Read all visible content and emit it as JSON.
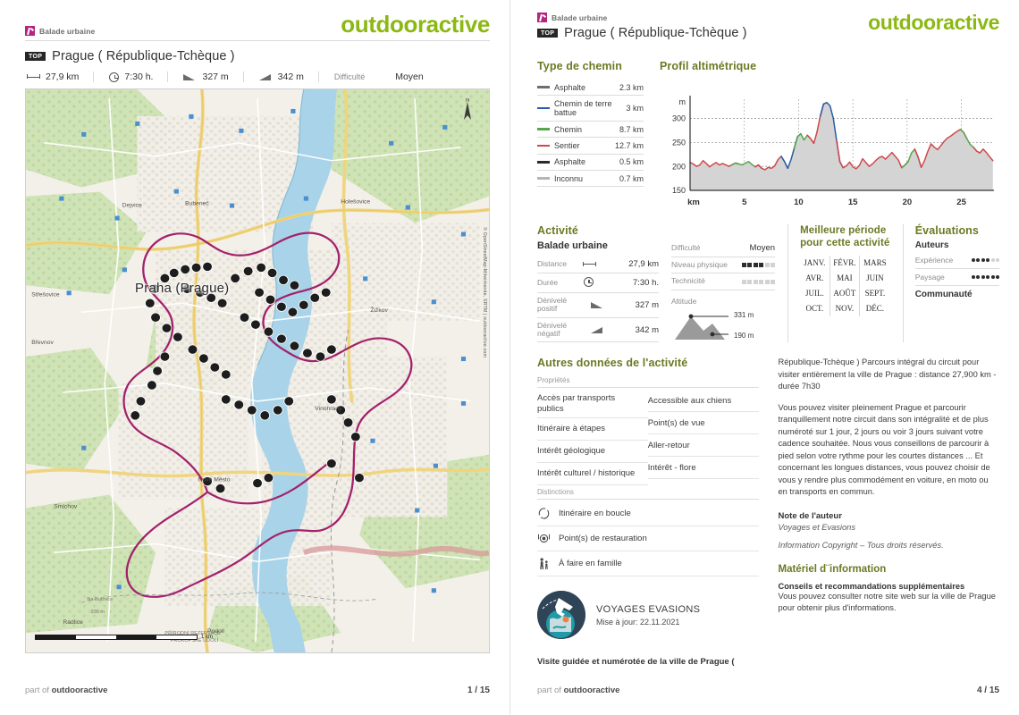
{
  "brand": "outdooractive",
  "category": "Balade urbaine",
  "top_badge": "TOP",
  "tour_title": "Prague ( République-Tchèque )",
  "stats": [
    {
      "icon": "distance-icon",
      "label": "",
      "value": "27,9 km"
    },
    {
      "icon": "clock-icon",
      "label": "",
      "value": "7:30 h."
    },
    {
      "icon": "ascent-icon",
      "label": "",
      "value": "327 m"
    },
    {
      "icon": "descent-icon",
      "label": "",
      "value": "342 m"
    },
    {
      "icon": "",
      "label": "Difficulté",
      "value": "Moyen"
    }
  ],
  "map": {
    "city_label": "Praha (Prague)",
    "attribution": "© OpenStreetMap-Mitwirkende, SRTM | outdooractive.com",
    "scale_text": "1 km",
    "compass_label": "N",
    "route_color": "#a3216b",
    "waypoint_count": 60
  },
  "path_types": {
    "heading": "Type de chemin",
    "rows": [
      {
        "name": "Asphalte",
        "value": "2.3 km",
        "color": "#6e6e6e"
      },
      {
        "name": "Chemin de terre battue",
        "value": "3 km",
        "color": "#2a5ca8"
      },
      {
        "name": "Chemin",
        "value": "8.7 km",
        "color": "#56a64b"
      },
      {
        "name": "Sentier",
        "value": "12.7 km",
        "color": "#d0484c"
      },
      {
        "name": "Asphalte",
        "value": "0.5 km",
        "color": "#2a2a2a"
      },
      {
        "name": "Inconnu",
        "value": "0.7 km",
        "color": "#b4b4b4"
      }
    ]
  },
  "chart_data": {
    "type": "area",
    "title": "Profil altimétrique",
    "xlabel": "km",
    "ylabel": "m",
    "xlim": [
      0,
      28
    ],
    "ylim": [
      150,
      340
    ],
    "xticks": [
      5,
      10,
      15,
      20,
      25
    ],
    "yticks": [
      150,
      200,
      250,
      300
    ],
    "grid": true,
    "legend": "none",
    "series_colors": {
      "Asphalte": "#6e6e6e",
      "Chemin de terre battue": "#2a5ca8",
      "Chemin": "#56a64b",
      "Sentier": "#d0484c"
    },
    "fill_color": "#d4d4d4",
    "x": [
      0,
      0.3,
      0.6,
      0.9,
      1.2,
      1.5,
      1.8,
      2.1,
      2.4,
      2.7,
      3,
      3.3,
      3.6,
      3.9,
      4.2,
      4.5,
      4.8,
      5.1,
      5.4,
      5.7,
      6,
      6.3,
      6.6,
      6.9,
      7.2,
      7.5,
      7.8,
      8.1,
      8.4,
      8.7,
      9,
      9.3,
      9.6,
      9.9,
      10.2,
      10.5,
      10.8,
      11.1,
      11.4,
      11.7,
      12,
      12.3,
      12.6,
      12.9,
      13.2,
      13.5,
      13.8,
      14.1,
      14.4,
      14.7,
      15,
      15.3,
      15.6,
      15.9,
      16.2,
      16.5,
      16.8,
      17.1,
      17.4,
      17.7,
      18,
      18.3,
      18.6,
      18.9,
      19.2,
      19.5,
      19.8,
      20.1,
      20.4,
      20.7,
      21,
      21.3,
      21.6,
      21.9,
      22.2,
      22.5,
      22.8,
      23.1,
      23.4,
      23.7,
      24,
      24.3,
      24.6,
      24.9,
      25.2,
      25.5,
      25.8,
      26.1,
      26.4,
      26.7,
      27,
      27.3,
      27.6,
      27.9
    ],
    "y": [
      208,
      205,
      200,
      203,
      212,
      206,
      199,
      204,
      208,
      203,
      206,
      203,
      200,
      204,
      207,
      205,
      203,
      207,
      210,
      204,
      199,
      203,
      196,
      193,
      198,
      196,
      201,
      214,
      221,
      210,
      196,
      214,
      238,
      262,
      268,
      255,
      265,
      258,
      248,
      272,
      305,
      330,
      333,
      326,
      300,
      254,
      210,
      197,
      201,
      209,
      199,
      195,
      202,
      216,
      208,
      200,
      205,
      212,
      218,
      221,
      215,
      222,
      229,
      221,
      213,
      197,
      203,
      210,
      228,
      236,
      220,
      198,
      212,
      231,
      247,
      240,
      235,
      243,
      252,
      259,
      263,
      268,
      273,
      277,
      271,
      258,
      246,
      240,
      232,
      228,
      236,
      229,
      220,
      212,
      205,
      203
    ],
    "segments": [
      {
        "type": "Sentier",
        "from": 0,
        "to": 4.2
      },
      {
        "type": "Chemin",
        "from": 4.2,
        "to": 6.3
      },
      {
        "type": "Sentier",
        "from": 6.3,
        "to": 8.7
      },
      {
        "type": "Chemin de terre battue",
        "from": 8.7,
        "to": 9.9
      },
      {
        "type": "Chemin",
        "from": 9.9,
        "to": 11.1
      },
      {
        "type": "Sentier",
        "from": 11.1,
        "to": 12.3
      },
      {
        "type": "Chemin de terre battue",
        "from": 12.3,
        "to": 13.8
      },
      {
        "type": "Sentier",
        "from": 13.8,
        "to": 19.8
      },
      {
        "type": "Chemin",
        "from": 19.8,
        "to": 21
      },
      {
        "type": "Sentier",
        "from": 21,
        "to": 25.2
      },
      {
        "type": "Chemin",
        "from": 25.2,
        "to": 26.4
      },
      {
        "type": "Sentier",
        "from": 26.4,
        "to": 27.9
      }
    ]
  },
  "activity": {
    "heading": "Activité",
    "name": "Balade urbaine",
    "rows": [
      {
        "key": "Distance",
        "icon": "distance-icon",
        "value": "27,9 km"
      },
      {
        "key": "Durée",
        "icon": "clock-icon",
        "value": "7:30 h."
      },
      {
        "key": "Dénivelé positif",
        "icon": "ascent-icon",
        "value": "327 m"
      },
      {
        "key": "Dénivelé négatif",
        "icon": "descent-icon",
        "value": "342 m"
      }
    ],
    "difficulty_label": "Difficulté",
    "difficulty_value": "Moyen",
    "physical_label": "Niveau physique",
    "physical_filled": 4,
    "physical_total": 6,
    "technical_label": "Technicité",
    "technical_filled": 0,
    "technical_total": 6,
    "altitude_label": "Altitude",
    "altitude_max": "331 m",
    "altitude_min": "190 m"
  },
  "best_period": {
    "heading_line1": "Meilleure période",
    "heading_line2": "pour cette activité",
    "months": [
      "JANV.",
      "FÉVR.",
      "MARS",
      "AVR.",
      "MAI",
      "JUIN",
      "JUIL.",
      "AOÛT",
      "SEPT.",
      "OCT.",
      "NOV.",
      "DÉC."
    ]
  },
  "ratings": {
    "heading": "Évaluations",
    "authors_label": "Auteurs",
    "rows": [
      {
        "key": "Expérience",
        "filled": 4,
        "total": 6
      },
      {
        "key": "Paysage",
        "filled": 6,
        "total": 6
      }
    ],
    "community_label": "Communauté"
  },
  "other_data": {
    "heading": "Autres données de l'activité",
    "properties_label": "Propriétés",
    "properties_col1": [
      "Accès par transports publics",
      "Itinéraire à étapes",
      "Intérêt géologique",
      "Intérêt culturel / historique"
    ],
    "properties_col2": [
      "Accessible aux chiens",
      "Point(s) de vue",
      "Aller-retour",
      "Intérêt - flore"
    ],
    "distinctions_label": "Distinctions",
    "distinctions": [
      {
        "icon": "loop-route-icon",
        "label": "Itinéraire en boucle"
      },
      {
        "icon": "restaurant-icon",
        "label": "Point(s) de restauration"
      },
      {
        "icon": "family-icon",
        "label": "À faire en famille"
      }
    ]
  },
  "author": {
    "logo_icon": "globe-plane-icon",
    "name": "VOYAGES EVASIONS",
    "updated": "Mise à jour: 22.11.2021",
    "guide_line": "Visite guidée et numérotée de la ville de Prague ("
  },
  "description": {
    "para1": "République-Tchèque ) Parcours intégral du circuit pour visiter entièrement la ville de Prague : distance 27,900 km - durée 7h30",
    "para2": "Vous pouvez visiter pleinement Prague et parcourir tranquillement notre circuit dans son intégralité et de plus numéroté sur 1 jour, 2 jours ou voir 3 jours suivant votre cadence souhaitée. Nous vous conseillons de parcourir à pied selon votre rythme pour les courtes distances ... Et concernant les longues distances, vous pouvez choisir de vous y rendre plus commodément en voiture, en moto ou en transports en commun.",
    "note_heading": "Note de l'auteur",
    "note_value": "Voyages et Evasions",
    "copyright": "Information Copyright – Tous droits réservés.",
    "material_heading": "Matériel d¨information",
    "material_line1": "Conseils et recommandations supplémentaires",
    "material_line2": "Vous pouvez consulter notre site web sur la ville de Prague pour obtenir plus d'informations."
  },
  "footer": {
    "part_of": "part of",
    "brand": "outdooractive",
    "page_left": "1 / 15",
    "page_right": "4 / 15"
  }
}
